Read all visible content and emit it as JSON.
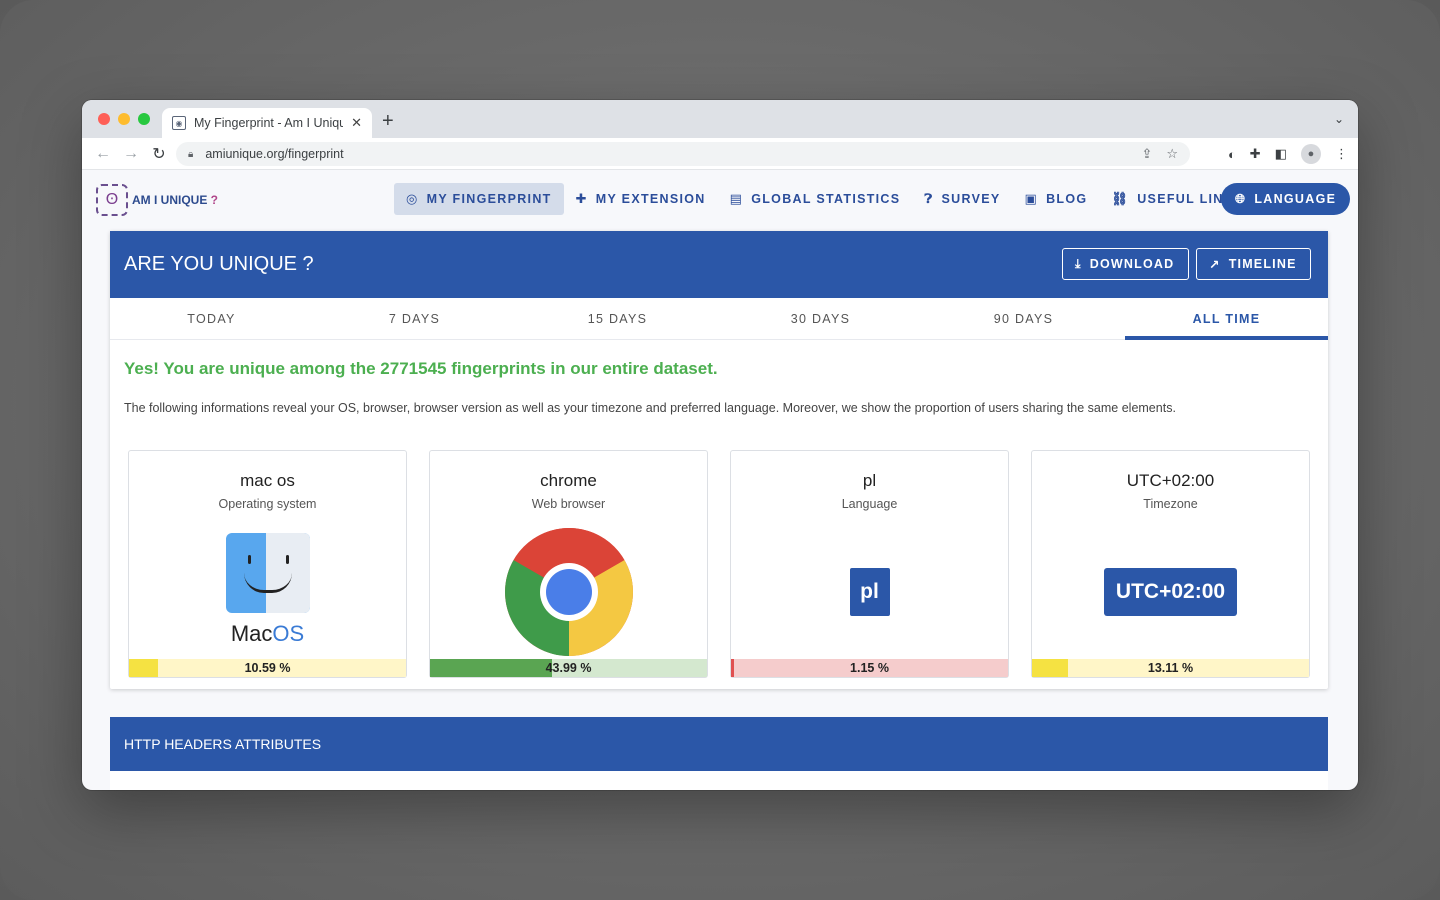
{
  "browser": {
    "tab_title": "My Fingerprint - Am I Uniqu",
    "url": "amiunique.org/fingerprint"
  },
  "site": {
    "logo_text": "AM I UNIQUE",
    "logo_q": " ?",
    "nav": [
      {
        "label": "MY FINGERPRINT",
        "icon": "fingerprint-icon"
      },
      {
        "label": "MY EXTENSION",
        "icon": "puzzle-icon"
      },
      {
        "label": "GLOBAL STATISTICS",
        "icon": "bar-chart-icon"
      },
      {
        "label": "SURVEY",
        "icon": "question-icon"
      },
      {
        "label": "BLOG",
        "icon": "blog-icon"
      },
      {
        "label": "USEFUL LINKS",
        "icon": "link-icon"
      }
    ],
    "language_label": "LANGUAGE"
  },
  "card": {
    "title": "ARE YOU UNIQUE ?",
    "download_label": "DOWNLOAD",
    "timeline_label": "TIMELINE",
    "ranges": [
      "TODAY",
      "7 DAYS",
      "15 DAYS",
      "30 DAYS",
      "90 DAYS",
      "ALL TIME"
    ],
    "active_range": "ALL TIME",
    "unique_message": "Yes! You are unique among the 2771545 fingerprints in our entire dataset.",
    "info_text": "The following informations reveal your OS, browser, browser version as well as your timezone and preferred language. Moreover, we show the proportion of users sharing the same elements.",
    "attributes": [
      {
        "value": "mac os",
        "label": "Operating system",
        "percent_text": "10.59 %",
        "percent": 10.59,
        "wordmark_a": "Mac",
        "wordmark_b": "OS"
      },
      {
        "value": "chrome",
        "label": "Web browser",
        "percent_text": "43.99 %",
        "percent": 43.99
      },
      {
        "value": "pl",
        "label": "Language",
        "percent_text": "1.15 %",
        "percent": 1.15,
        "badge": "pl"
      },
      {
        "value": "UTC+02:00",
        "label": "Timezone",
        "percent_text": "13.11 %",
        "percent": 13.11,
        "badge": "UTC+02:00"
      }
    ]
  },
  "http_section": {
    "title": "HTTP HEADERS ATTRIBUTES"
  },
  "colors": {
    "primary": "#2b57a8",
    "success_text": "#4caf50"
  }
}
